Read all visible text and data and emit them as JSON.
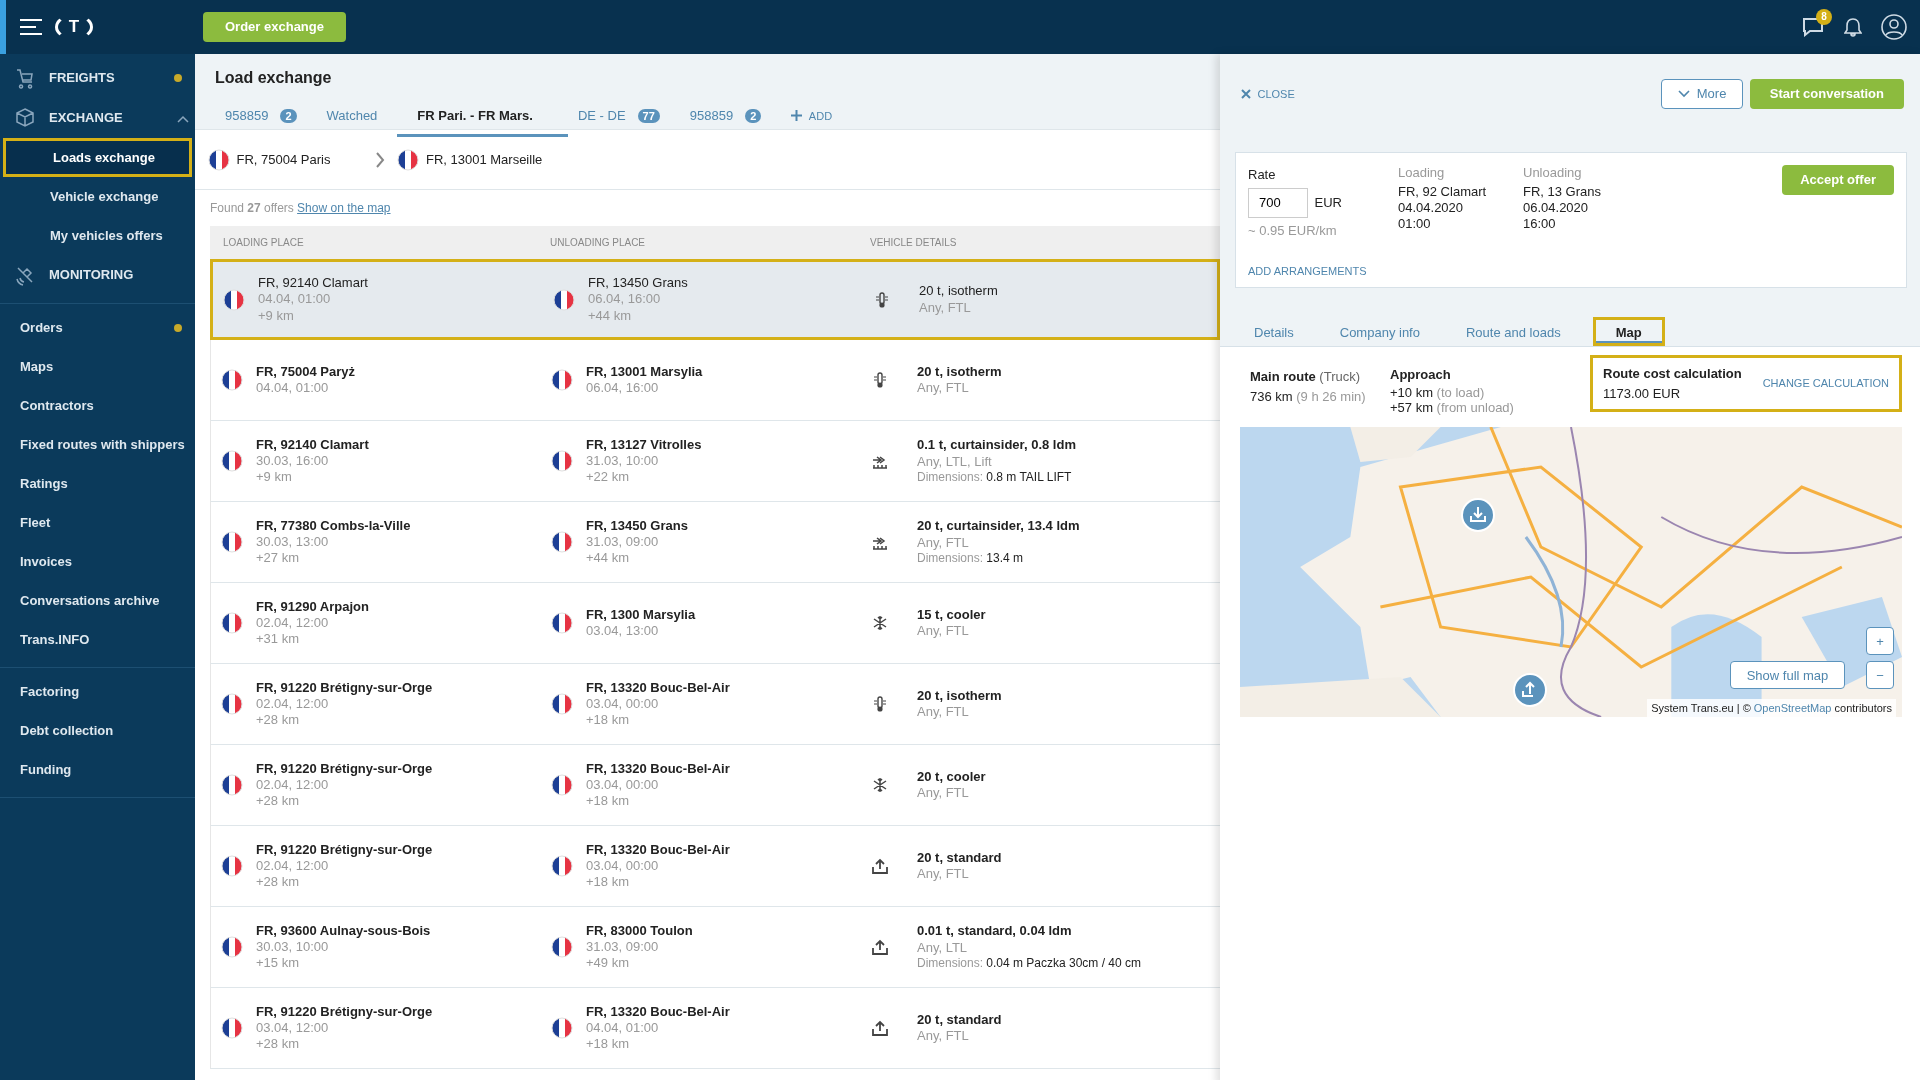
{
  "header": {
    "logo": "T",
    "order_button": "Order exchange",
    "messages_badge": "8"
  },
  "sidebar": {
    "groups": [
      {
        "items": [
          {
            "label": "FREIGHTS",
            "kind": "section",
            "dot": true,
            "expanded": false
          },
          {
            "label": "EXCHANGE",
            "kind": "section",
            "dot": false,
            "expanded": true,
            "children": [
              {
                "label": "Loads exchange",
                "selected": true
              },
              {
                "label": "Vehicle exchange",
                "selected": false
              },
              {
                "label": "My vehicles offers",
                "selected": false
              }
            ]
          },
          {
            "label": "MONITORING",
            "kind": "section",
            "dot": false,
            "expanded": false
          }
        ]
      },
      {
        "items": [
          {
            "label": "Orders",
            "kind": "link",
            "dot": true
          },
          {
            "label": "Maps",
            "kind": "link",
            "dot": false
          },
          {
            "label": "Contractors",
            "kind": "link",
            "dot": false
          },
          {
            "label": "Fixed routes with shippers",
            "kind": "link",
            "dot": false
          },
          {
            "label": "Ratings",
            "kind": "link",
            "dot": false
          },
          {
            "label": "Fleet",
            "kind": "link",
            "dot": false
          },
          {
            "label": "Invoices",
            "kind": "link",
            "dot": false
          },
          {
            "label": "Conversations archive",
            "kind": "link",
            "dot": false
          },
          {
            "label": "Trans.INFO",
            "kind": "link",
            "dot": false
          }
        ]
      },
      {
        "items": [
          {
            "label": "Factoring",
            "kind": "link",
            "dot": false
          },
          {
            "label": "Debt collection",
            "kind": "link",
            "dot": false
          },
          {
            "label": "Funding",
            "kind": "link",
            "dot": false
          }
        ]
      }
    ]
  },
  "exchange": {
    "title": "Load exchange",
    "tabs": [
      {
        "label": "958859",
        "count": "2",
        "selected": false
      },
      {
        "label": "Watched",
        "selected": false
      },
      {
        "label": "FR Pari. - FR Mars.",
        "selected": true
      },
      {
        "label": "DE - DE",
        "count": "77",
        "selected": false
      },
      {
        "label": "958859",
        "count": "2",
        "selected": false
      }
    ],
    "add_tab": "ADD",
    "route": {
      "from": "FR, 75004 Paris",
      "to": "FR, 13001 Marseille"
    },
    "found": "Found **27** offers",
    "map_link": "Show on the map",
    "columns": [
      "LOADING PLACE",
      "UNLOADING PLACE",
      "VEHICLE DETAILS"
    ],
    "rows": [
      {
        "selected": true,
        "loading": {
          "place": "FR, 92140 Clamart",
          "date": "04.04, 01:00",
          "distance": "+9 km"
        },
        "unloading": {
          "place": "FR, 13450 Grans",
          "date": "06.04, 16:00",
          "distance": "+44 km"
        },
        "kind": "isotherm",
        "vehicle": {
          "title": "20 t, isotherm",
          "sub": "Any, FTL"
        }
      },
      {
        "selected": false,
        "loading": {
          "place": "FR, 75004 Paryż",
          "date": "04.04, 01:00"
        },
        "unloading": {
          "place": "FR, 13001 Marsylia",
          "date": "06.04, 16:00"
        },
        "kind": "isotherm",
        "vehicle": {
          "title": "20 t, isotherm",
          "sub": "Any, FTL"
        }
      },
      {
        "selected": false,
        "loading": {
          "place": "FR, 92140 Clamart",
          "date": "30.03, 16:00",
          "distance": "+9 km"
        },
        "unloading": {
          "place": "FR, 13127 Vitrolles",
          "date": "31.03, 10:00",
          "distance": "+22 km"
        },
        "kind": "curtainsider",
        "vehicle": {
          "title": "0.1 t, curtainsider, 0.8 ldm",
          "sub": "Any, LTL, Lift",
          "dim_label": "Dimensions:",
          "dim_value": "0.8 m TAIL LIFT"
        }
      },
      {
        "selected": false,
        "loading": {
          "place": "FR, 77380 Combs-la-Ville",
          "date": "30.03, 13:00",
          "distance": "+27 km"
        },
        "unloading": {
          "place": "FR, 13450 Grans",
          "date": "31.03, 09:00",
          "distance": "+44 km"
        },
        "kind": "curtainsider",
        "vehicle": {
          "title": "20 t, curtainsider, 13.4 ldm",
          "sub": "Any, FTL",
          "dim_label": "Dimensions:",
          "dim_value": "13.4 m"
        }
      },
      {
        "selected": false,
        "loading": {
          "place": "FR, 91290 Arpajon",
          "date": "02.04, 12:00",
          "distance": "+31 km"
        },
        "unloading": {
          "place": "FR, 1300 Marsylia",
          "date": "03.04, 13:00"
        },
        "kind": "cooler",
        "vehicle": {
          "title": "15 t, cooler",
          "sub": "Any, FTL"
        }
      },
      {
        "selected": false,
        "loading": {
          "place": "FR, 91220 Brétigny-sur-Orge",
          "date": "02.04, 12:00",
          "distance": "+28 km"
        },
        "unloading": {
          "place": "FR, 13320 Bouc-Bel-Air",
          "date": "03.04, 00:00",
          "distance": "+18 km"
        },
        "kind": "isotherm",
        "vehicle": {
          "title": "20 t, isotherm",
          "sub": "Any, FTL"
        }
      },
      {
        "selected": false,
        "loading": {
          "place": "FR, 91220 Brétigny-sur-Orge",
          "date": "02.04, 12:00",
          "distance": "+28 km"
        },
        "unloading": {
          "place": "FR, 13320 Bouc-Bel-Air",
          "date": "03.04, 00:00",
          "distance": "+18 km"
        },
        "kind": "cooler",
        "vehicle": {
          "title": "20 t, cooler",
          "sub": "Any, FTL"
        }
      },
      {
        "selected": false,
        "loading": {
          "place": "FR, 91220 Brétigny-sur-Orge",
          "date": "02.04, 12:00",
          "distance": "+28 km"
        },
        "unloading": {
          "place": "FR, 13320 Bouc-Bel-Air",
          "date": "03.04, 00:00",
          "distance": "+18 km"
        },
        "kind": "standard",
        "vehicle": {
          "title": "20 t, standard",
          "sub": "Any, FTL"
        }
      },
      {
        "selected": false,
        "loading": {
          "place": "FR, 93600 Aulnay-sous-Bois",
          "date": "30.03, 10:00",
          "distance": "+15 km"
        },
        "unloading": {
          "place": "FR, 83000 Toulon",
          "date": "31.03, 09:00",
          "distance": "+49 km"
        },
        "kind": "standard",
        "vehicle": {
          "title": "0.01 t, standard, 0.04 ldm",
          "sub": "Any, LTL",
          "dim_label": "Dimensions:",
          "dim_value": "0.04 m Paczka 30cm / 40 cm"
        }
      },
      {
        "selected": false,
        "loading": {
          "place": "FR, 91220 Brétigny-sur-Orge",
          "date": "03.04, 12:00",
          "distance": "+28 km"
        },
        "unloading": {
          "place": "FR, 13320 Bouc-Bel-Air",
          "date": "04.04, 01:00",
          "distance": "+18 km"
        },
        "kind": "standard",
        "vehicle": {
          "title": "20 t, standard",
          "sub": "Any, FTL"
        }
      }
    ]
  },
  "detail": {
    "close": "CLOSE",
    "more": "More",
    "start": "Start conversation",
    "rate": {
      "label": "Rate",
      "value": "700",
      "currency": "EUR",
      "per_km": "~ 0.95 EUR/km"
    },
    "loading": {
      "label": "Loading",
      "lines": [
        "FR, 92 Clamart",
        "04.04.2020",
        "01:00"
      ]
    },
    "unloading": {
      "label": "Unloading",
      "lines": [
        "FR, 13 Grans",
        "06.04.2020",
        "16:00"
      ]
    },
    "accept": "Accept offer",
    "add_arrangements": "ADD ARRANGEMENTS",
    "tabs": [
      {
        "label": "Details",
        "selected": false
      },
      {
        "label": "Company info",
        "selected": false
      },
      {
        "label": "Route and loads",
        "selected": false
      },
      {
        "label": "Map",
        "selected": true
      }
    ],
    "main_route": {
      "title": "Main route",
      "mode": "(Truck)",
      "distance": "736 km",
      "time": "(9 h 26 min)"
    },
    "approach": {
      "title": "Approach",
      "lines": [
        {
          "value": "+10 km",
          "note": "(to load)"
        },
        {
          "value": "+57 km",
          "note": "(from unload)"
        }
      ]
    },
    "cost": {
      "title": "Route cost calculation",
      "value": "1173.00 EUR",
      "action": "CHANGE CALCULATION"
    },
    "map": {
      "show_full": "Show full map",
      "zoom_in": "+",
      "zoom_out": "−",
      "attribution": "System Trans.eu | © ",
      "attribution_link": "OpenStreetMap",
      "attribution_end": " contributors"
    }
  }
}
